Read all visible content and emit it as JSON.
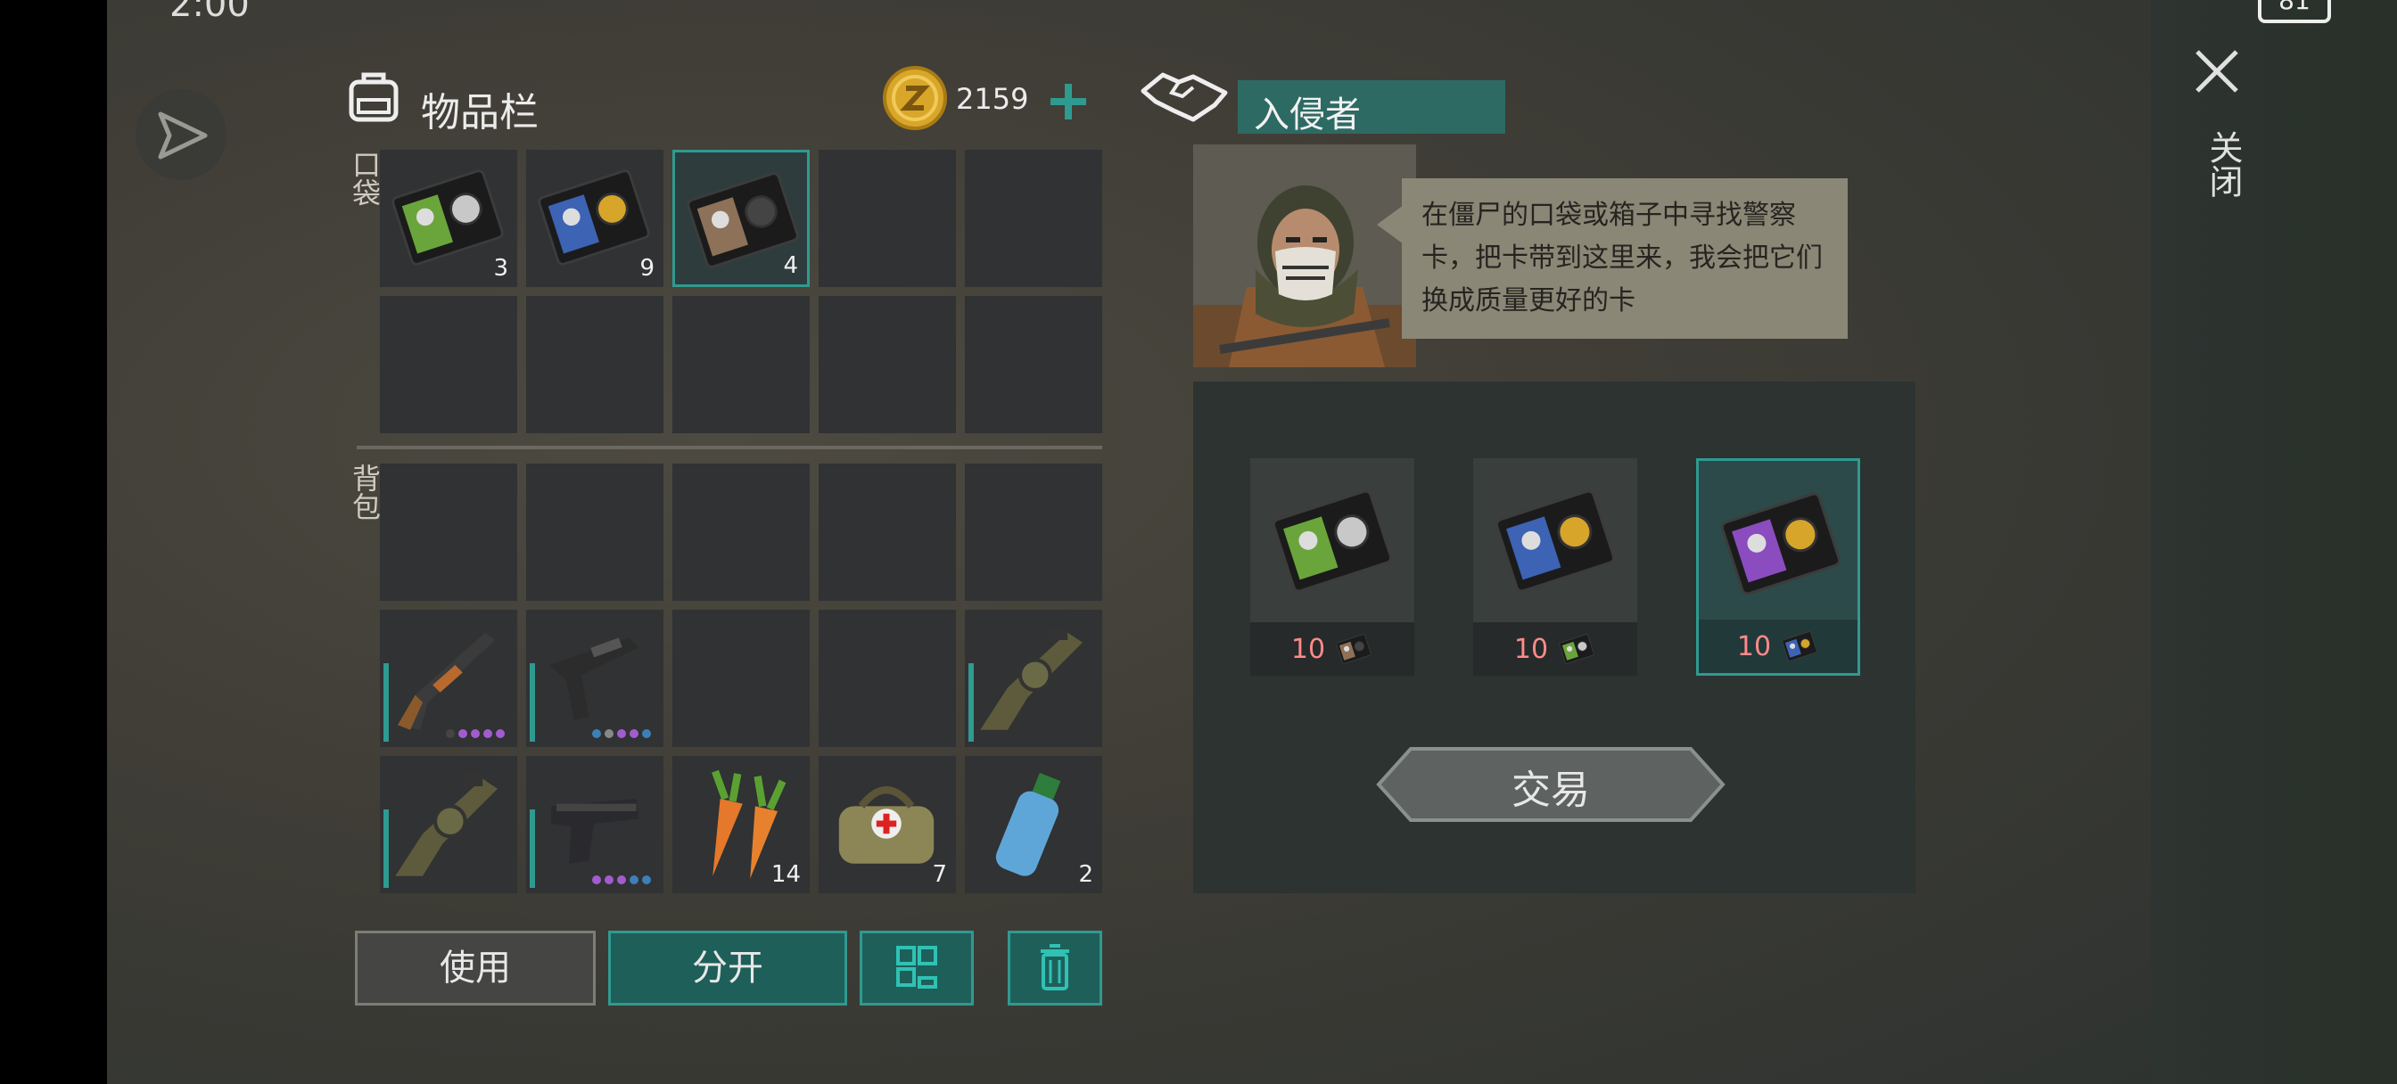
{
  "status": {
    "time": "2:00",
    "battery": "81"
  },
  "inventory": {
    "title": "物品栏",
    "coins": "2159",
    "pocket_label": "口袋",
    "backpack_label": "背包",
    "pocket_slots": [
      {
        "item": "green-police-card-icon",
        "count": "3"
      },
      {
        "item": "blue-police-card-icon",
        "count": "9"
      },
      {
        "item": "brown-police-card-icon",
        "count": "4",
        "selected": true
      },
      null,
      null,
      null,
      null,
      null,
      null,
      null
    ],
    "backpack_slots": [
      null,
      null,
      null,
      null,
      null,
      {
        "item": "pump-shotgun-icon",
        "dots": [
          "#444",
          "#a25ccf",
          "#a25ccf",
          "#a25ccf",
          "#a25ccf"
        ]
      },
      {
        "item": "smg-icon",
        "dots": [
          "#3d7fb8",
          "#888",
          "#a25ccf",
          "#a25ccf",
          "#3d7fb8"
        ]
      },
      null,
      null,
      {
        "item": "grenade-launcher-icon",
        "dots": []
      },
      {
        "item": "grenade-launcher-icon",
        "dots": []
      },
      {
        "item": "pistol-icon",
        "dots": [
          "#a25ccf",
          "#a25ccf",
          "#a25ccf",
          "#3d7fb8",
          "#3d7fb8"
        ]
      },
      {
        "item": "carrot-icon",
        "count": "14"
      },
      {
        "item": "medkit-bag-icon",
        "count": "7"
      },
      {
        "item": "water-bottle-icon",
        "count": "2"
      }
    ],
    "buttons": {
      "use": "使用",
      "split": "分开"
    }
  },
  "trader": {
    "name": "入侵者",
    "dialog": "在僵尸的口袋或箱子中寻找警察卡，把卡带到这里来，我会把它们换成质量更好的卡",
    "offers": [
      {
        "item": "green-police-card-icon",
        "price": "10",
        "cost_item": "brown-police-card-icon"
      },
      {
        "item": "blue-police-card-icon",
        "price": "10",
        "cost_item": "green-police-card-icon"
      },
      {
        "item": "purple-police-card-icon",
        "price": "10",
        "cost_item": "blue-police-card-icon",
        "selected": true
      }
    ],
    "trade_button": "交易"
  },
  "close_label": "关闭",
  "colors": {
    "accent": "#2f9a90",
    "coin": "#d8a72a",
    "price": "#ff8a8a"
  }
}
